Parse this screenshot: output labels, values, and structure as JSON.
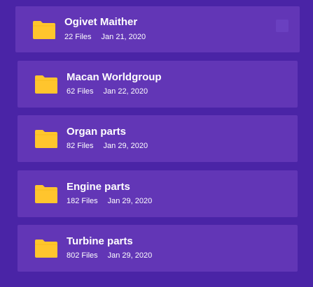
{
  "folders": [
    {
      "name": "Ogivet Maither",
      "files": "22 Files",
      "date": "Jan 21, 2020",
      "icon": "folder-icon",
      "hovered": true
    },
    {
      "name": "Macan Worldgroup",
      "files": "62 Files",
      "date": "Jan 22, 2020",
      "icon": "folder-icon"
    },
    {
      "name": "Organ parts",
      "files": "82 Files",
      "date": "Jan 29, 2020",
      "icon": "folder-icon"
    },
    {
      "name": "Engine parts",
      "files": "182 Files",
      "date": "Jan 29, 2020",
      "icon": "folder-icon"
    },
    {
      "name": "Turbine parts",
      "files": "802 Files",
      "date": "Jan 29, 2020",
      "icon": "folder-icon"
    }
  ],
  "colors": {
    "background": "#4a24a6",
    "card": "#6236b6",
    "folder": "#ffc52d",
    "text": "#ffffff"
  }
}
